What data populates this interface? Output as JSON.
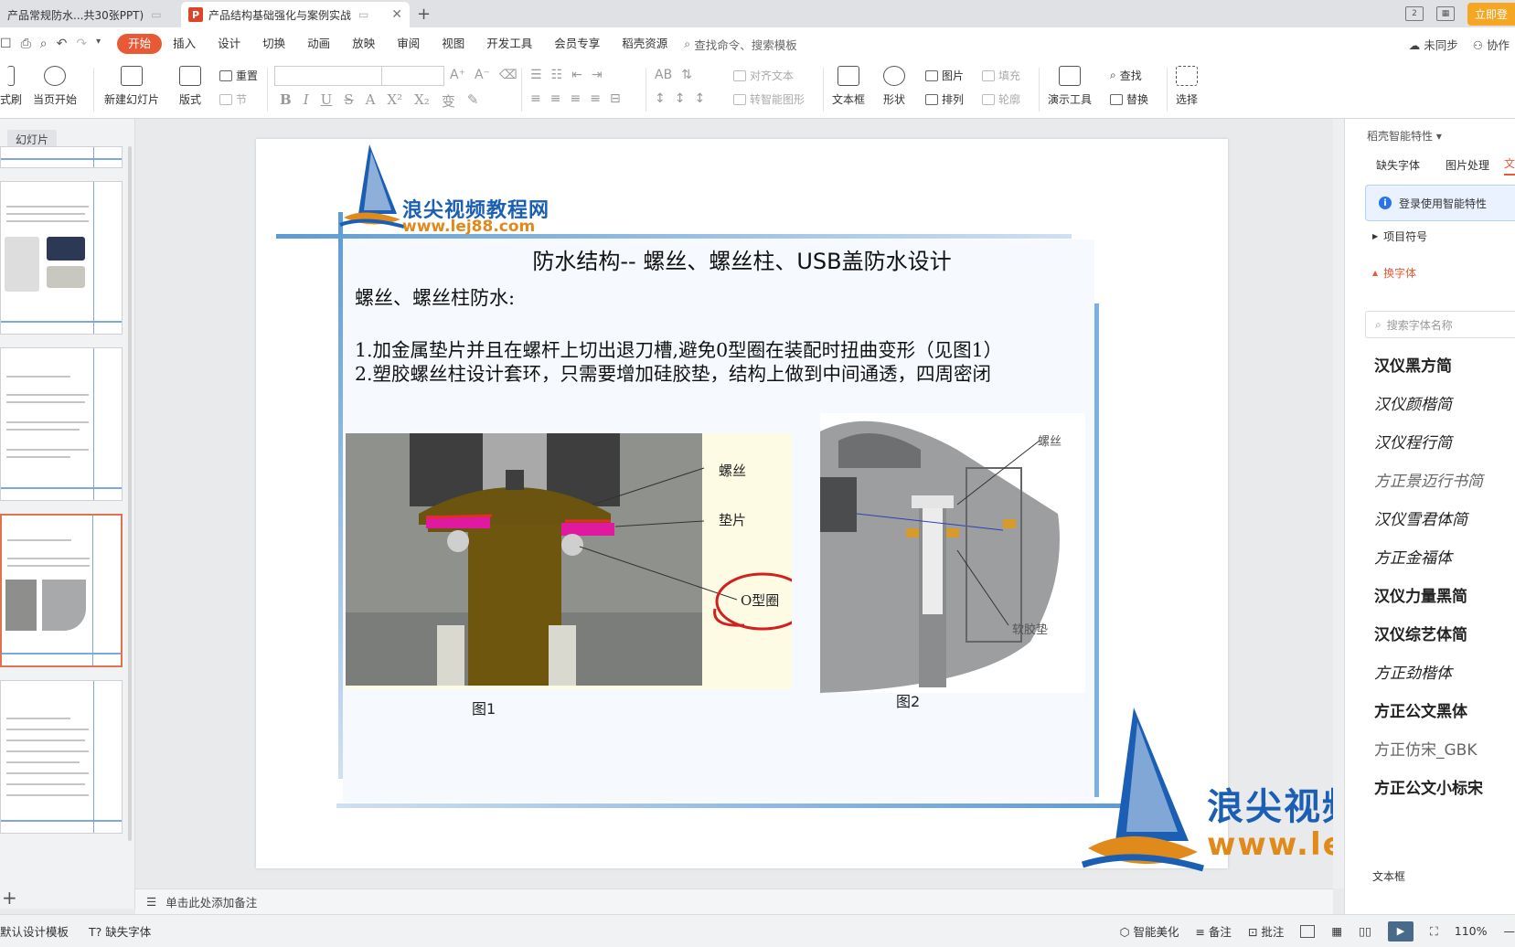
{
  "tabs": [
    {
      "label": "产品常规防水...共30张PPT)"
    },
    {
      "label": "产品结构基础强化与案例实战"
    }
  ],
  "titlebar": {
    "login_label": "立即登"
  },
  "menu": {
    "items": [
      "开始",
      "插入",
      "设计",
      "切换",
      "动画",
      "放映",
      "审阅",
      "视图",
      "开发工具",
      "会员专享",
      "稻壳资源"
    ],
    "search_label": "查找命令、搜索模板",
    "sync_label": "未同步",
    "collab_label": "协作"
  },
  "ribbon": {
    "current_start": "当页开始",
    "new_slide": "新建幻灯片",
    "layout": "版式",
    "reset": "重置",
    "section": "节",
    "align_text": "对齐文本",
    "smartart": "转智能图形",
    "textbox": "文本框",
    "shape": "形状",
    "picture": "图片",
    "arrange": "排列",
    "fill": "填充",
    "outline": "轮廓",
    "present_tools": "演示工具",
    "find": "查找",
    "replace": "替换",
    "select": "选择",
    "left_cut": "式刷"
  },
  "leftpanel": {
    "tab_label": "幻灯片"
  },
  "slide": {
    "logo_brand": "浪尖视频教程网",
    "logo_url": "www.lej88.com",
    "title": "防水结构-- 螺丝、螺丝柱、USB盖防水设计",
    "subtitle": "螺丝、螺丝柱防水:",
    "point1": "1.加金属垫片并且在螺杆上切出退刀槽,避免0型圈在装配时扭曲变形（见图1）",
    "point2": "2.塑胶螺丝柱设计套环，只需要增加硅胶垫，结构上做到中间通透，四周密闭",
    "fig1_labels": {
      "screw": "螺丝",
      "washer": "垫片",
      "oring": "O型圈"
    },
    "fig2_labels": {
      "screw": "螺丝",
      "pad": "软胶垫"
    },
    "fig1_caption": "图1",
    "fig2_caption": "图2"
  },
  "notes": {
    "placeholder": "单击此处添加备注"
  },
  "rightpanel": {
    "title": "稻壳智能特性",
    "tab_missing_font": "缺失字体",
    "tab_picture": "图片处理",
    "tab_active": "文",
    "login_label": "登录使用智能特性",
    "bullets_label": "项目符号",
    "font_swap_label": "换字体",
    "font_search_placeholder": "搜索字体名称",
    "fonts": [
      "汉仪黑方简",
      "汉仪颜楷简",
      "汉仪程行简",
      "方正景迈行书简",
      "汉仪雪君体简",
      "方正金福体",
      "汉仪力量黑简",
      "汉仪综艺体简",
      "方正劲楷体",
      "方正公文黑体",
      "方正仿宋_GBK",
      "方正公文小标宋"
    ],
    "bottom_label": "文本框"
  },
  "statusbar": {
    "template": "默认设计模板",
    "missing_font": "缺失字体",
    "beautify": "智能美化",
    "notes": "备注",
    "comment": "批注",
    "zoom": "110%"
  }
}
